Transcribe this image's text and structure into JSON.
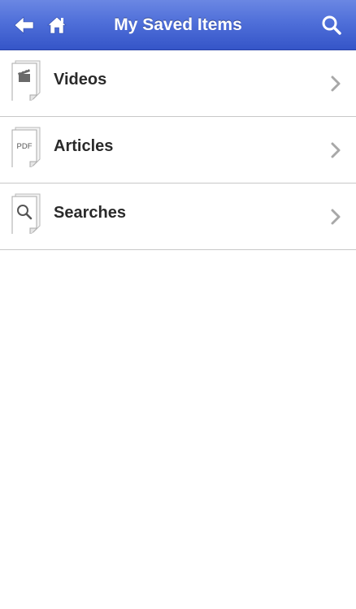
{
  "header": {
    "title": "My Saved Items",
    "back_icon": "back-arrow-icon",
    "home_icon": "home-icon",
    "search_icon": "search-icon",
    "background_color": "#4f6fd9"
  },
  "list": {
    "items": [
      {
        "label": "Videos",
        "icon": "video-clapperboard-icon"
      },
      {
        "label": "Articles",
        "icon": "pdf-document-icon",
        "icon_text": "PDF"
      },
      {
        "label": "Searches",
        "icon": "search-document-icon"
      }
    ]
  }
}
